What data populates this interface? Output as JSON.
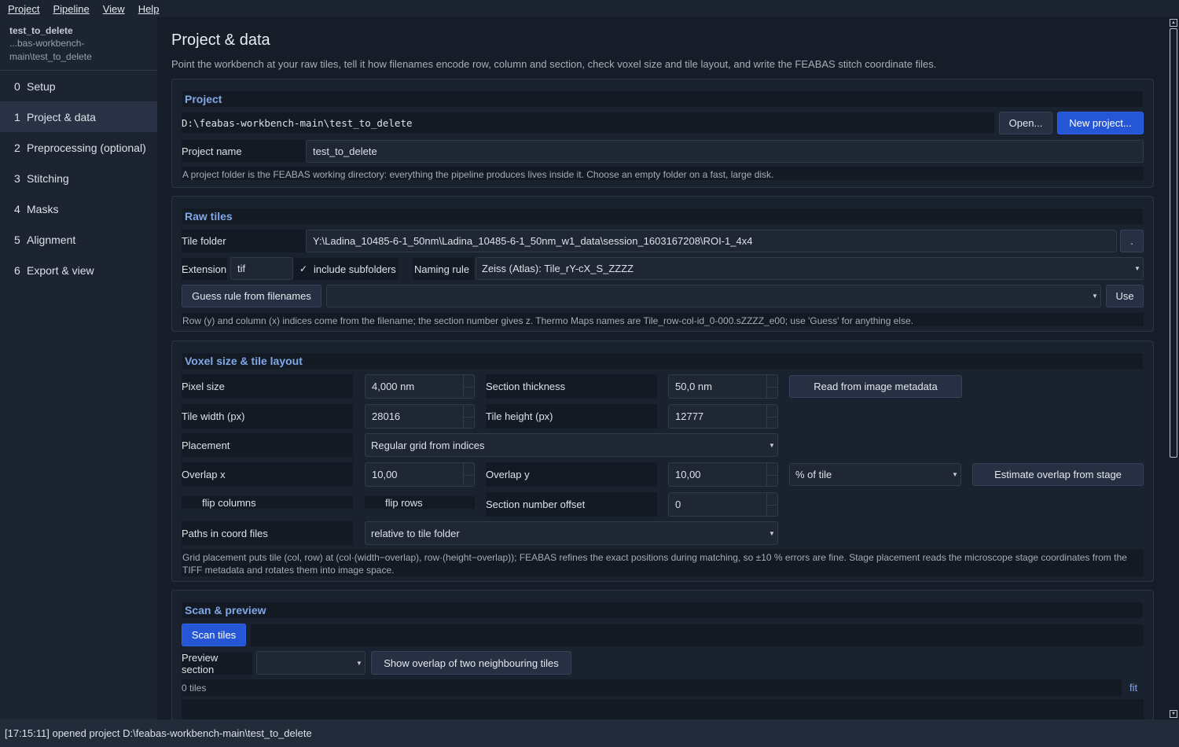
{
  "menu": [
    "Project",
    "Pipeline",
    "View",
    "Help"
  ],
  "project_header": {
    "name": "test_to_delete",
    "path_line1": "...bas-workbench-",
    "path_line2": "main\\test_to_delete"
  },
  "nav": [
    {
      "num": "0",
      "label": "Setup"
    },
    {
      "num": "1",
      "label": "Project & data"
    },
    {
      "num": "2",
      "label": "Preprocessing (optional)"
    },
    {
      "num": "3",
      "label": "Stitching"
    },
    {
      "num": "4",
      "label": "Masks"
    },
    {
      "num": "5",
      "label": "Alignment"
    },
    {
      "num": "6",
      "label": "Export & view"
    }
  ],
  "page": {
    "title": "Project & data",
    "description": "Point the workbench at your raw tiles, tell it how filenames encode row, column and section, check voxel size and tile layout, and write the FEABAS stitch coordinate files."
  },
  "project_group": {
    "title": "Project",
    "path": "D:\\feabas-workbench-main\\test_to_delete",
    "open_label": "Open...",
    "new_label": "New project...",
    "name_label": "Project name",
    "name_value": "test_to_delete",
    "hint": "A project folder is the FEABAS working directory: everything the pipeline produces lives inside it. Choose an empty folder on a fast, large disk."
  },
  "raw_tiles": {
    "title": "Raw tiles",
    "folder_label": "Tile folder",
    "folder_value": "Y:\\Ladina_10485-6-1_50nm\\Ladina_10485-6-1_50nm_w1_data\\session_1603167208\\ROI-1_4x4",
    "browse_label": ".",
    "extension_label": "Extension",
    "extension_value": "tif",
    "include_subfolders_check": "✓",
    "include_subfolders_label": "include subfolders",
    "naming_label": "Naming rule",
    "naming_value": "Zeiss (Atlas): Tile_rY-cX_S_ZZZZ",
    "guess_label": "Guess rule from filenames",
    "guess_value": "",
    "use_label": "Use",
    "hint": "Row (y) and column (x) indices come from the filename; the section number gives z. Thermo Maps names are Tile_row-col-id_0-000.sZZZZ_e00; use 'Guess' for anything else."
  },
  "voxel": {
    "title": "Voxel size & tile layout",
    "pixel_size_label": "Pixel size",
    "pixel_size_value": "4,000 nm",
    "section_thickness_label": "Section thickness",
    "section_thickness_value": "50,0 nm",
    "read_meta_label": "Read from image metadata",
    "tile_width_label": "Tile width (px)",
    "tile_width_value": "28016",
    "tile_height_label": "Tile height (px)",
    "tile_height_value": "12777",
    "placement_label": "Placement",
    "placement_value": "Regular grid from indices",
    "overlap_x_label": "Overlap x",
    "overlap_x_value": "10,00",
    "overlap_y_label": "Overlap y",
    "overlap_y_value": "10,00",
    "overlap_unit_value": "% of tile",
    "estimate_label": "Estimate overlap from stage",
    "flip_columns_label": "flip columns",
    "flip_rows_label": "flip rows",
    "section_offset_label": "Section number offset",
    "section_offset_value": "0",
    "paths_label": "Paths in coord files",
    "paths_value": "relative to tile folder",
    "hint": "Grid placement puts tile (col, row) at (col·(width−overlap), row·(height−overlap)); FEABAS refines the exact positions during matching, so ±10 % errors are fine. Stage placement reads the microscope stage coordinates from the TIFF metadata and rotates them into image space."
  },
  "scan": {
    "title": "Scan & preview",
    "scan_label": "Scan tiles",
    "preview_label": "Preview section",
    "preview_value": "",
    "show_overlap_label": "Show overlap of two neighbouring tiles",
    "tiles_count": "0 tiles",
    "fit_label": "fit"
  },
  "status": "[17:15:11] opened project D:\\feabas-workbench-main\\test_to_delete",
  "colors": {
    "accent": "#2556d6",
    "group_title": "#7fa8e6",
    "background": "#161d28"
  }
}
